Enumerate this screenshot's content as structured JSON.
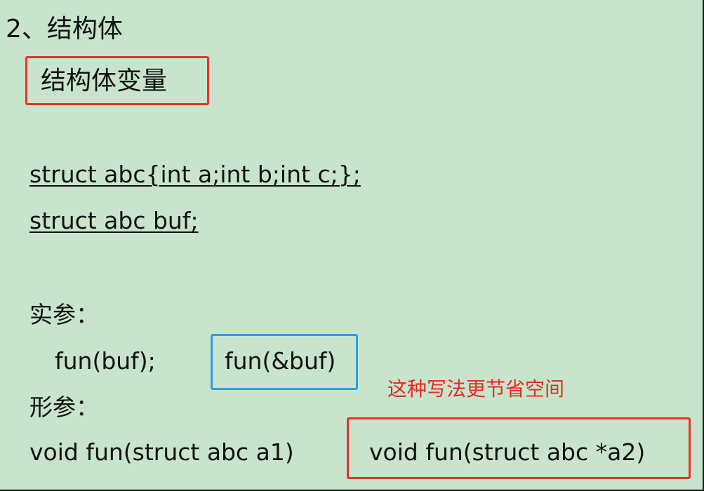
{
  "slide": {
    "heading": "2、结构体",
    "subtitle": "结构体变量",
    "code_lines": [
      "struct abc{int a;int b;int c;};",
      "struct abc buf;"
    ],
    "actual_param_label": "实参：",
    "calls": [
      "fun(buf);",
      "fun(&buf)"
    ],
    "note": "这种写法更节省空间",
    "formal_param_label": "形参：",
    "prototypes": [
      "void fun(struct abc a1)",
      "void fun(struct abc *a2)"
    ]
  },
  "colors": {
    "background": "#c8e4cc",
    "highlight_red": "#e8312a",
    "highlight_blue": "#2a9ee8",
    "note_text": "#e82a22"
  }
}
